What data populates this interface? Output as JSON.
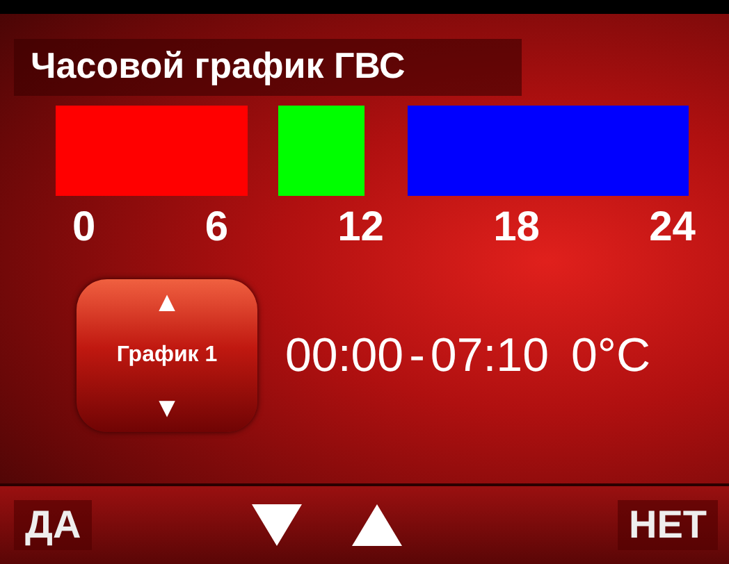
{
  "title": "Часовой график ГВС",
  "timeline": {
    "segments": [
      {
        "color": "#ff0000"
      },
      {
        "color": "#00ff00"
      },
      {
        "color": "#0000ff"
      }
    ],
    "ticks": [
      "0",
      "6",
      "12",
      "18",
      "24"
    ]
  },
  "schedule": {
    "label": "График 1",
    "up": "▲",
    "down": "▼"
  },
  "interval": {
    "start": "00:00",
    "separator": "-",
    "end": "07:10",
    "temperature": "0°C"
  },
  "softkeys": [
    {
      "kind": "text",
      "label": "ДА"
    },
    {
      "kind": "down"
    },
    {
      "kind": "up"
    },
    {
      "kind": "text",
      "label": "НЕТ"
    }
  ]
}
